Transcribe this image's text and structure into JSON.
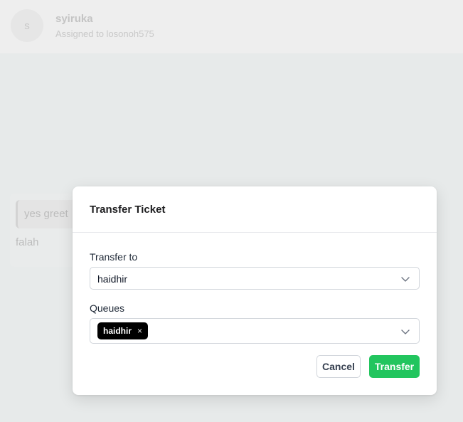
{
  "contact": {
    "avatar_initial": "s",
    "name": "syiruka",
    "assigned": "Assigned to losonoh575"
  },
  "chat": {
    "bubble_text": "yes greet",
    "sender": "falah"
  },
  "modal": {
    "title": "Transfer Ticket",
    "transfer_to_label": "Transfer to",
    "transfer_to_value": "haidhir",
    "queues_label": "Queues",
    "queue_tags": [
      "haidhir"
    ],
    "tag_remove_symbol": "×",
    "cancel_label": "Cancel",
    "transfer_label": "Transfer"
  },
  "colors": {
    "transfer_button": "#22c55e",
    "tag_background": "#000000"
  },
  "icons": {
    "dropdown": "chevron-down-icon",
    "tag_remove": "close-icon"
  }
}
